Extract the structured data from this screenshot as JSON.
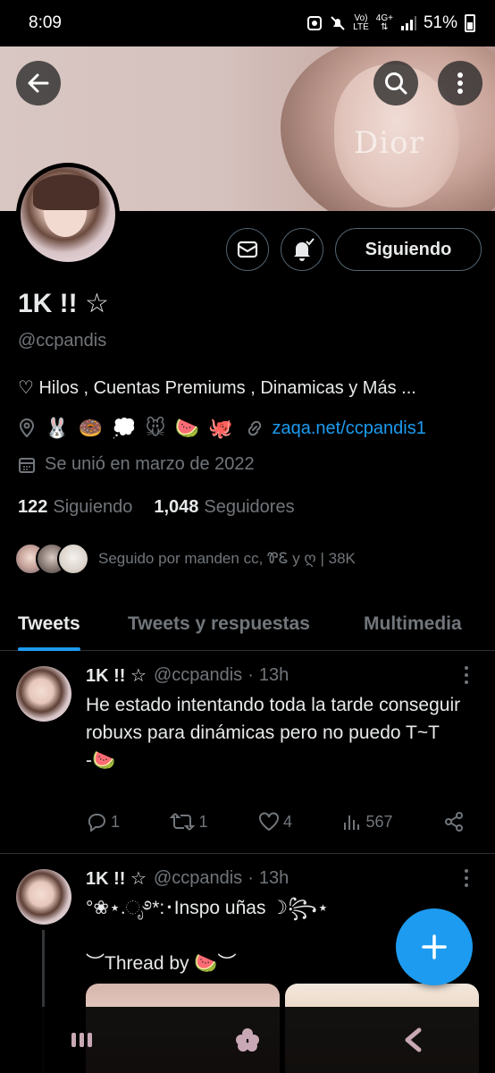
{
  "status_bar": {
    "time": "8:09",
    "network_top": "Vo)",
    "network_bottom": "LTE",
    "data_type": "4G+",
    "battery": "51%"
  },
  "banner": {
    "brand_text": "Dior"
  },
  "profile": {
    "display_name": "1K !! ☆",
    "handle": "@ccpandis",
    "bio": "♡ Hilos , Cuentas Premiums , Dinamicas y Más ...",
    "location_emojis": "🐰 🍩 💭 🐭 🍉 🐙",
    "link": "zaqa.net/ccpandis1",
    "joined": "Se unió en marzo de 2022",
    "following_count": "122",
    "following_label": "Siguiendo",
    "followers_count": "1,048",
    "followers_label": "Seguidores",
    "followed_by": "Seguido por manden cc, ᏈᏋ y ღ | 38K"
  },
  "actions": {
    "follow_label": "Siguiendo"
  },
  "tabs": [
    {
      "label": "Tweets",
      "active": true
    },
    {
      "label": "Tweets y respuestas",
      "active": false
    },
    {
      "label": "Multimedia",
      "active": false
    }
  ],
  "tweets": [
    {
      "name": "1K !! ☆",
      "handle": "@ccpandis",
      "time": "13h",
      "body": "He estado intentando toda la tarde conseguir robuxs para dinámicas pero no puedo T~T\n-🍉",
      "replies": "1",
      "retweets": "1",
      "likes": "4",
      "views": "567"
    },
    {
      "name": "1K !! ☆",
      "handle": "@ccpandis",
      "time": "13h",
      "body": "°❀⋆.ೃ࿔*:･Inspo uñas ☽꧂⋆\n\n︶Thread by 🍉︶"
    }
  ],
  "colors": {
    "accent": "#1d9bf0",
    "background": "#000000",
    "text_primary": "#e7e9ea",
    "text_secondary": "#71767b",
    "border": "#2f3336"
  },
  "icons": {
    "back": "arrow-left-icon",
    "search": "search-icon",
    "more": "more-vertical-icon",
    "message": "envelope-icon",
    "notifications": "bell-check-icon",
    "location": "location-pin-icon",
    "link": "link-icon",
    "calendar": "calendar-icon",
    "reply": "reply-icon",
    "retweet": "retweet-icon",
    "like": "heart-icon",
    "views": "views-icon",
    "share": "share-icon",
    "compose": "plus-icon",
    "nav_recents": "recents-icon",
    "nav_home": "home-icon",
    "nav_back": "nav-back-icon"
  }
}
